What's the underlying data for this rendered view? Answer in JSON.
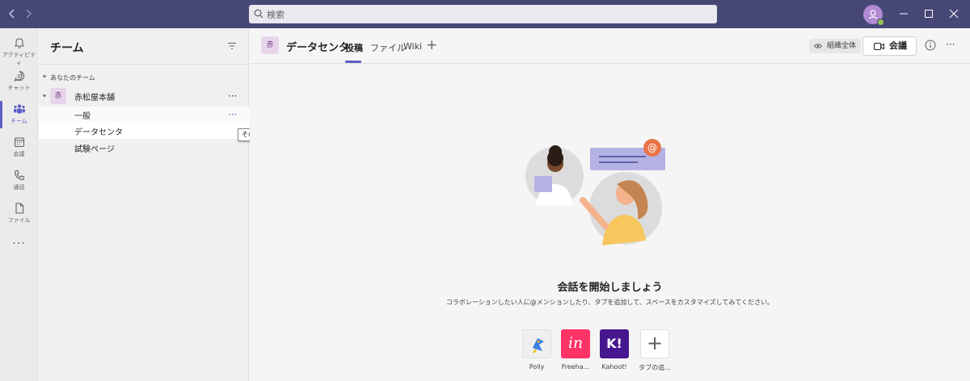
{
  "titlebar": {
    "back_icon": "chevron-left-icon",
    "forward_icon": "chevron-right-icon",
    "search_placeholder": "検索",
    "colors": {
      "bar": "#464775",
      "presence": "#92c353"
    }
  },
  "rail": {
    "items": [
      {
        "label": "アクティビティ",
        "icon": "bell-icon"
      },
      {
        "label": "チャット",
        "icon": "chat-icon"
      },
      {
        "label": "チーム",
        "icon": "teams-icon",
        "active": true
      },
      {
        "label": "会議",
        "icon": "calendar-icon"
      },
      {
        "label": "通話",
        "icon": "phone-icon"
      },
      {
        "label": "ファイル",
        "icon": "file-icon"
      }
    ],
    "more": "..."
  },
  "teams_panel": {
    "title": "チーム",
    "section_label": "あなたのチーム",
    "team": {
      "avatar": "赤",
      "name": "赤松屋本舗"
    },
    "channels": [
      {
        "name": "一般"
      },
      {
        "name": "データセンタ"
      },
      {
        "name": "試験ページ"
      }
    ],
    "tooltip": "その他のオプション"
  },
  "channel_header": {
    "avatar": "赤",
    "name": "データセンタ",
    "tabs": [
      "投稿",
      "ファイル",
      "Wiki"
    ],
    "active_tab": "投稿",
    "org_label": "組織全体",
    "meet_label": "会議"
  },
  "empty_state": {
    "headline": "会話を開始しましょう",
    "subline": "コラボレーションしたい人に@メンションしたり、タブを追加して、スペースをカスタマイズしてみてください。"
  },
  "apps": [
    {
      "name": "Polly",
      "icon": "polly-icon"
    },
    {
      "name": "Freeha...",
      "icon": "invision-icon",
      "glyph": "in",
      "color": "#ff3366"
    },
    {
      "name": "Kahoot!",
      "icon": "kahoot-icon",
      "glyph": "K!",
      "color": "#46178f"
    },
    {
      "name": "タブの追...",
      "icon": "plus-icon",
      "glyph": "+"
    }
  ],
  "accent_color": "#5b5fc7"
}
